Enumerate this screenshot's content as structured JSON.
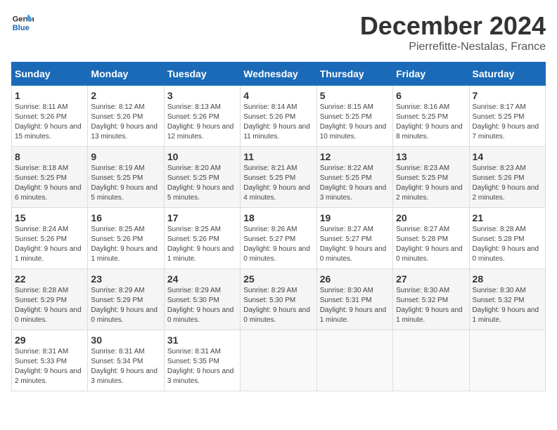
{
  "logo": {
    "line1": "General",
    "line2": "Blue"
  },
  "title": "December 2024",
  "location": "Pierrefitte-Nestalas, France",
  "days_of_week": [
    "Sunday",
    "Monday",
    "Tuesday",
    "Wednesday",
    "Thursday",
    "Friday",
    "Saturday"
  ],
  "weeks": [
    [
      {
        "day": "1",
        "sunrise": "8:11 AM",
        "sunset": "5:26 PM",
        "daylight": "9 hours and 15 minutes."
      },
      {
        "day": "2",
        "sunrise": "8:12 AM",
        "sunset": "5:26 PM",
        "daylight": "9 hours and 13 minutes."
      },
      {
        "day": "3",
        "sunrise": "8:13 AM",
        "sunset": "5:26 PM",
        "daylight": "9 hours and 12 minutes."
      },
      {
        "day": "4",
        "sunrise": "8:14 AM",
        "sunset": "5:26 PM",
        "daylight": "9 hours and 11 minutes."
      },
      {
        "day": "5",
        "sunrise": "8:15 AM",
        "sunset": "5:25 PM",
        "daylight": "9 hours and 10 minutes."
      },
      {
        "day": "6",
        "sunrise": "8:16 AM",
        "sunset": "5:25 PM",
        "daylight": "9 hours and 8 minutes."
      },
      {
        "day": "7",
        "sunrise": "8:17 AM",
        "sunset": "5:25 PM",
        "daylight": "9 hours and 7 minutes."
      }
    ],
    [
      {
        "day": "8",
        "sunrise": "8:18 AM",
        "sunset": "5:25 PM",
        "daylight": "9 hours and 6 minutes."
      },
      {
        "day": "9",
        "sunrise": "8:19 AM",
        "sunset": "5:25 PM",
        "daylight": "9 hours and 5 minutes."
      },
      {
        "day": "10",
        "sunrise": "8:20 AM",
        "sunset": "5:25 PM",
        "daylight": "9 hours and 5 minutes."
      },
      {
        "day": "11",
        "sunrise": "8:21 AM",
        "sunset": "5:25 PM",
        "daylight": "9 hours and 4 minutes."
      },
      {
        "day": "12",
        "sunrise": "8:22 AM",
        "sunset": "5:25 PM",
        "daylight": "9 hours and 3 minutes."
      },
      {
        "day": "13",
        "sunrise": "8:23 AM",
        "sunset": "5:25 PM",
        "daylight": "9 hours and 2 minutes."
      },
      {
        "day": "14",
        "sunrise": "8:23 AM",
        "sunset": "5:26 PM",
        "daylight": "9 hours and 2 minutes."
      }
    ],
    [
      {
        "day": "15",
        "sunrise": "8:24 AM",
        "sunset": "5:26 PM",
        "daylight": "9 hours and 1 minute."
      },
      {
        "day": "16",
        "sunrise": "8:25 AM",
        "sunset": "5:26 PM",
        "daylight": "9 hours and 1 minute."
      },
      {
        "day": "17",
        "sunrise": "8:25 AM",
        "sunset": "5:26 PM",
        "daylight": "9 hours and 1 minute."
      },
      {
        "day": "18",
        "sunrise": "8:26 AM",
        "sunset": "5:27 PM",
        "daylight": "9 hours and 0 minutes."
      },
      {
        "day": "19",
        "sunrise": "8:27 AM",
        "sunset": "5:27 PM",
        "daylight": "9 hours and 0 minutes."
      },
      {
        "day": "20",
        "sunrise": "8:27 AM",
        "sunset": "5:28 PM",
        "daylight": "9 hours and 0 minutes."
      },
      {
        "day": "21",
        "sunrise": "8:28 AM",
        "sunset": "5:28 PM",
        "daylight": "9 hours and 0 minutes."
      }
    ],
    [
      {
        "day": "22",
        "sunrise": "8:28 AM",
        "sunset": "5:29 PM",
        "daylight": "9 hours and 0 minutes."
      },
      {
        "day": "23",
        "sunrise": "8:29 AM",
        "sunset": "5:29 PM",
        "daylight": "9 hours and 0 minutes."
      },
      {
        "day": "24",
        "sunrise": "8:29 AM",
        "sunset": "5:30 PM",
        "daylight": "9 hours and 0 minutes."
      },
      {
        "day": "25",
        "sunrise": "8:29 AM",
        "sunset": "5:30 PM",
        "daylight": "9 hours and 0 minutes."
      },
      {
        "day": "26",
        "sunrise": "8:30 AM",
        "sunset": "5:31 PM",
        "daylight": "9 hours and 1 minute."
      },
      {
        "day": "27",
        "sunrise": "8:30 AM",
        "sunset": "5:32 PM",
        "daylight": "9 hours and 1 minute."
      },
      {
        "day": "28",
        "sunrise": "8:30 AM",
        "sunset": "5:32 PM",
        "daylight": "9 hours and 1 minute."
      }
    ],
    [
      {
        "day": "29",
        "sunrise": "8:31 AM",
        "sunset": "5:33 PM",
        "daylight": "9 hours and 2 minutes."
      },
      {
        "day": "30",
        "sunrise": "8:31 AM",
        "sunset": "5:34 PM",
        "daylight": "9 hours and 3 minutes."
      },
      {
        "day": "31",
        "sunrise": "8:31 AM",
        "sunset": "5:35 PM",
        "daylight": "9 hours and 3 minutes."
      },
      null,
      null,
      null,
      null
    ]
  ]
}
